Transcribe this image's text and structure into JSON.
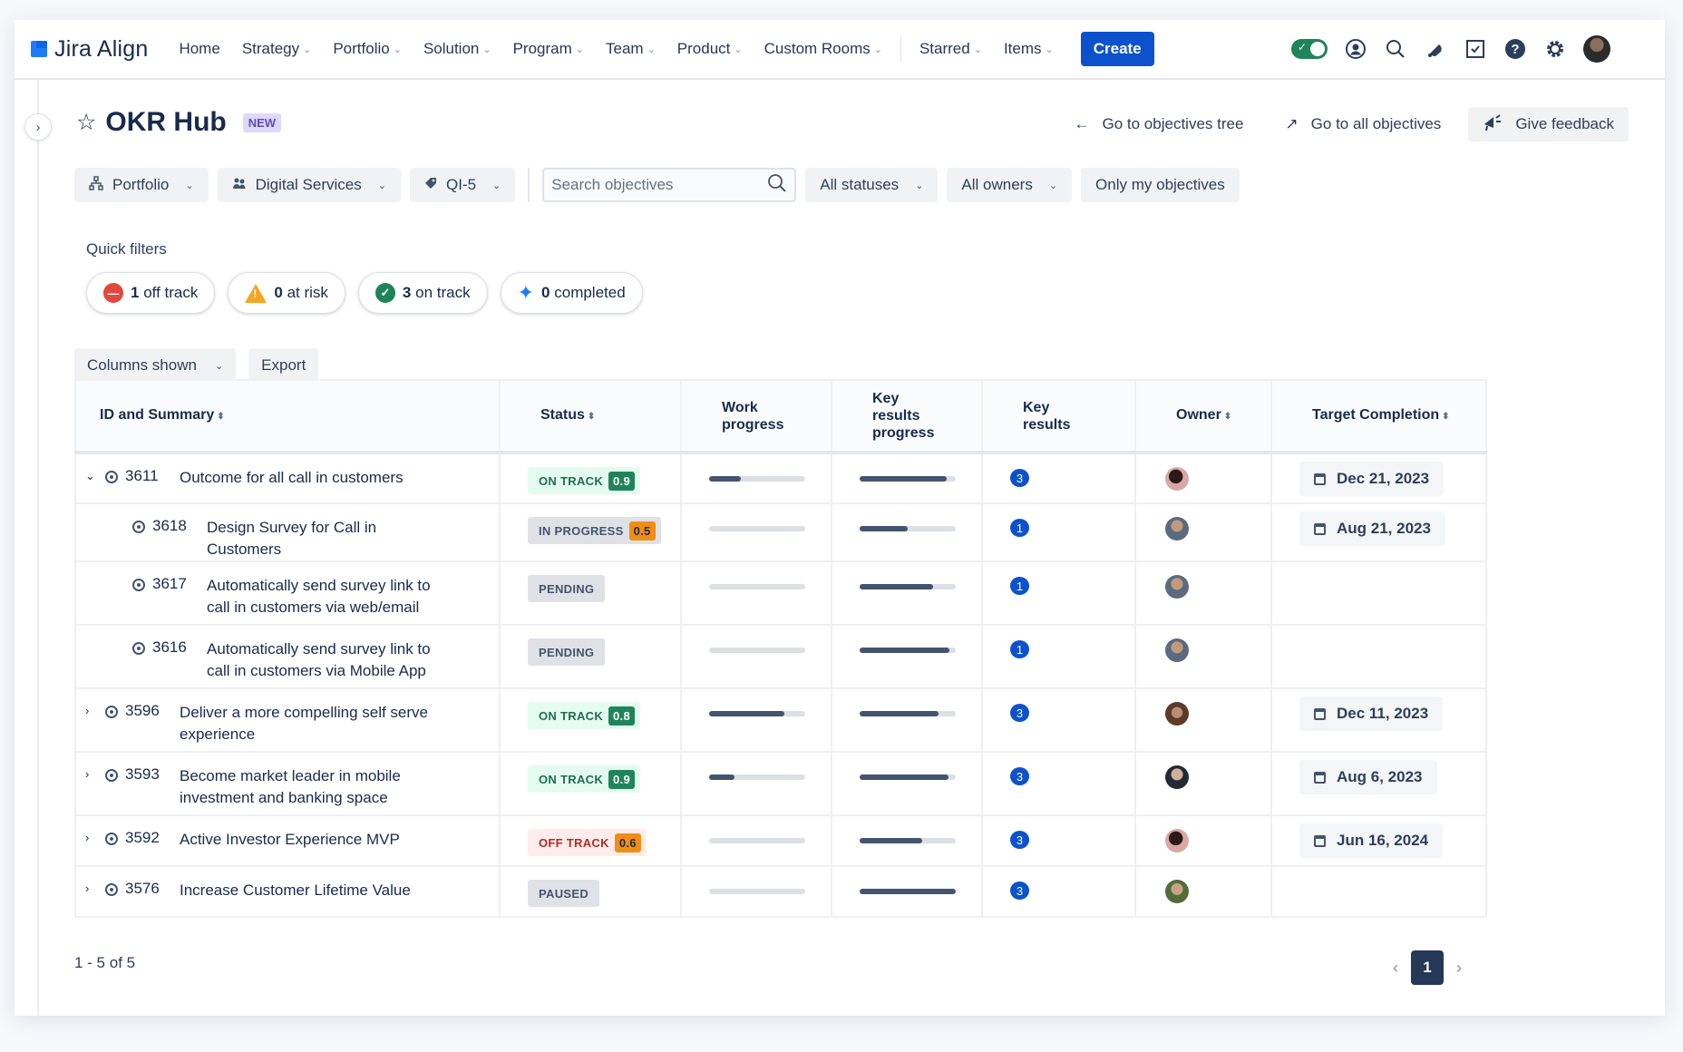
{
  "app": {
    "name": "Jira Align"
  },
  "nav": {
    "items": [
      {
        "label": "Home",
        "dropdown": false
      },
      {
        "label": "Strategy",
        "dropdown": true
      },
      {
        "label": "Portfolio",
        "dropdown": true
      },
      {
        "label": "Solution",
        "dropdown": true
      },
      {
        "label": "Program",
        "dropdown": true
      },
      {
        "label": "Team",
        "dropdown": true
      },
      {
        "label": "Product",
        "dropdown": true
      },
      {
        "label": "Custom Rooms",
        "dropdown": true
      }
    ],
    "secondary": [
      {
        "label": "Starred",
        "dropdown": true
      },
      {
        "label": "Items",
        "dropdown": true
      }
    ],
    "create_label": "Create",
    "icons": [
      "toggle-switch",
      "profile-icon",
      "search-icon",
      "notifications-icon",
      "tasks-icon",
      "help-icon",
      "settings-icon",
      "user-avatar"
    ],
    "toggle_on": true
  },
  "page": {
    "title": "OKR Hub",
    "badge": "NEW",
    "actions": {
      "tree": "Go to objectives tree",
      "all": "Go to all objectives",
      "feedback": "Give feedback"
    }
  },
  "filters": {
    "level": "Portfolio",
    "portfolio": "Digital Services",
    "increment": "QI-5",
    "search_placeholder": "Search objectives",
    "search_value": "",
    "statuses": "All statuses",
    "owners": "All owners",
    "mine": "Only my objectives"
  },
  "quick_filters": {
    "label": "Quick filters",
    "items": [
      {
        "count": "1",
        "label": "off track"
      },
      {
        "count": "0",
        "label": "at risk"
      },
      {
        "count": "3",
        "label": "on track"
      },
      {
        "count": "0",
        "label": "completed"
      }
    ]
  },
  "table_actions": {
    "columns": "Columns shown",
    "export": "Export"
  },
  "table": {
    "headers": {
      "id_summary": "ID and Summary",
      "status": "Status",
      "work_progress": "Work progress",
      "kr_progress": "Key results progress",
      "key_results": "Key results",
      "owner": "Owner",
      "target": "Target Completion"
    },
    "rows": [
      {
        "expander": "expanded",
        "child": false,
        "id": "3611",
        "summary": "Outcome for all call in customers",
        "status": "ON TRACK",
        "score": "0.9",
        "tone": "on",
        "work": 0.33,
        "kr": 0.91,
        "kr_count": "3",
        "avatar": "av1",
        "date": "Dec 21, 2023"
      },
      {
        "expander": "none",
        "child": true,
        "id": "3618",
        "summary": "Design Survey for Call in Customers",
        "status": "IN PROGRESS",
        "score": "0.5",
        "tone": "prog",
        "work": 0,
        "kr": 0.5,
        "kr_count": "1",
        "avatar": "av2",
        "date": "Aug 21, 2023"
      },
      {
        "expander": "none",
        "child": true,
        "id": "3617",
        "summary": "Automatically send survey link to call in customers via web/email",
        "status": "PENDING",
        "score": "",
        "tone": "pend",
        "work": 0,
        "kr": 0.76,
        "kr_count": "1",
        "avatar": "av2",
        "date": ""
      },
      {
        "expander": "none",
        "child": true,
        "id": "3616",
        "summary": "Automatically send survey link to call in customers via Mobile App",
        "status": "PENDING",
        "score": "",
        "tone": "pend",
        "work": 0,
        "kr": 0.93,
        "kr_count": "1",
        "avatar": "av2",
        "date": ""
      },
      {
        "expander": "collapsed",
        "child": false,
        "id": "3596",
        "summary": "Deliver a more compelling self serve experience",
        "status": "ON TRACK",
        "score": "0.8",
        "tone": "on",
        "work": 0.78,
        "kr": 0.82,
        "kr_count": "3",
        "avatar": "av3",
        "date": "Dec 11, 2023"
      },
      {
        "expander": "collapsed",
        "child": false,
        "id": "3593",
        "summary": "Become market leader in mobile investment and banking space",
        "status": "ON TRACK",
        "score": "0.9",
        "tone": "on",
        "work": 0.26,
        "kr": 0.92,
        "kr_count": "3",
        "avatar": "av4",
        "date": "Aug 6, 2023"
      },
      {
        "expander": "collapsed",
        "child": false,
        "id": "3592",
        "summary": "Active Investor Experience MVP",
        "status": "OFF TRACK",
        "score": "0.6",
        "tone": "off",
        "work": 0,
        "kr": 0.65,
        "kr_count": "3",
        "avatar": "av1",
        "date": "Jun 16, 2024"
      },
      {
        "expander": "collapsed",
        "child": false,
        "id": "3576",
        "summary": "Increase Customer Lifetime Value",
        "status": "PAUSED",
        "score": "",
        "tone": "pend",
        "work": 0,
        "kr": 1.0,
        "kr_count": "3",
        "avatar": "av5",
        "date": ""
      }
    ]
  },
  "pagination": {
    "summary": "1 - 5 of 5",
    "current_page": "1"
  }
}
